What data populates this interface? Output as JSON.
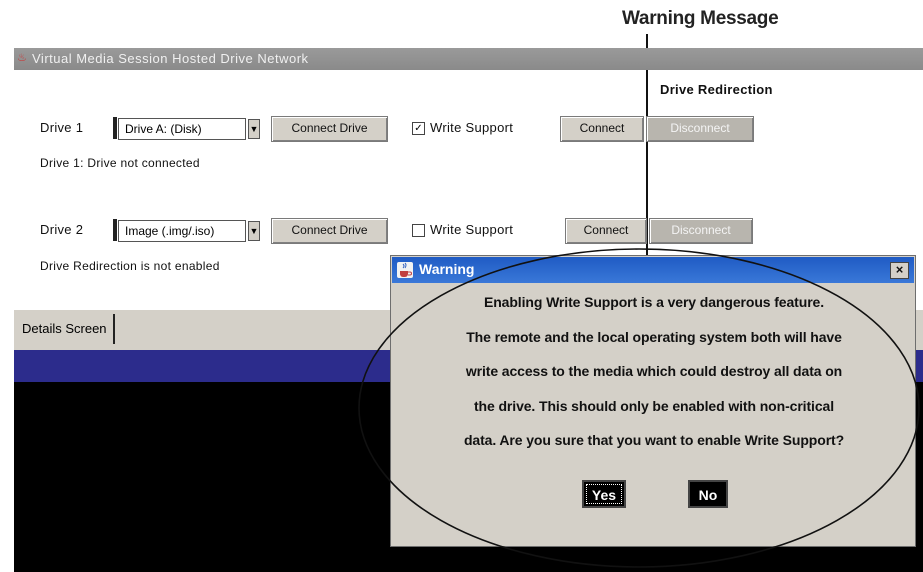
{
  "callout": {
    "label": "Warning Message"
  },
  "window": {
    "title": "Virtual Media Session Hosted Drive Network"
  },
  "top_right_text": "Drive Redirection",
  "drive1": {
    "label": "Drive 1",
    "combo_value": "Drive A: (Disk)",
    "map_button": "Connect Drive",
    "write_support_label": "Write Support",
    "write_support_checked": "✓",
    "button_a": "Connect",
    "button_b": "Disconnect",
    "status": "Drive 1: Drive not connected"
  },
  "drive2": {
    "label": "Drive 2",
    "combo_value": "Image (.img/.iso)",
    "map_button": "Connect Drive",
    "write_support_label": "Write Support",
    "button_a": "Connect",
    "button_b": "Disconnect",
    "status": "Drive Redirection is not enabled"
  },
  "tab": {
    "label": "Details Screen"
  },
  "dialog": {
    "title": "Warning",
    "close": "×",
    "message_lines": [
      "Enabling Write Support is a very dangerous feature.",
      "The remote and the local operating system both will have",
      "write access to the media which could destroy all data on",
      "the drive. This should only be enabled with non-critical",
      "data. Are you sure that you want to enable Write Support?"
    ],
    "yes": "Yes",
    "no": "No"
  },
  "colors": {
    "dialog_title_bg": "#2a68d0",
    "console_header": "#2c2c8c",
    "console_body": "#000000",
    "panel_gray": "#d4d0c8"
  }
}
